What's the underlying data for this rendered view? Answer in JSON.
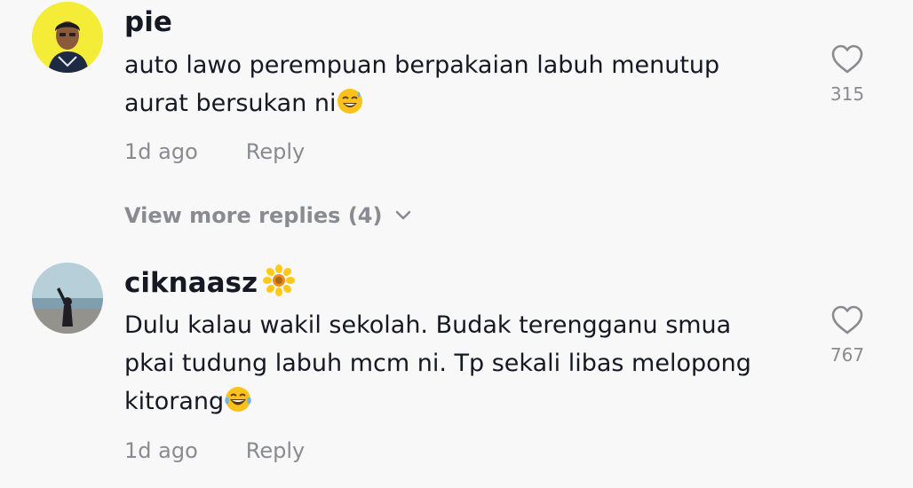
{
  "comments": [
    {
      "username": "pie",
      "text": "auto lawo perempuan berpakaian labuh menutup\naurat bersukan ni",
      "emoji": "sweat-smile-emoji",
      "time": "1d ago",
      "reply_label": "Reply",
      "likes": "315",
      "view_more": "View more replies (4)"
    },
    {
      "username": "ciknaasz",
      "badge": "sunflower-emoji",
      "text": "Dulu kalau wakil sekolah. Budak terengganu smua\npkai tudung labuh mcm ni. Tp sekali libas melopong\nkitorang",
      "emoji": "tears-of-joy-emoji",
      "time": "1d ago",
      "reply_label": "Reply",
      "likes": "767"
    }
  ]
}
